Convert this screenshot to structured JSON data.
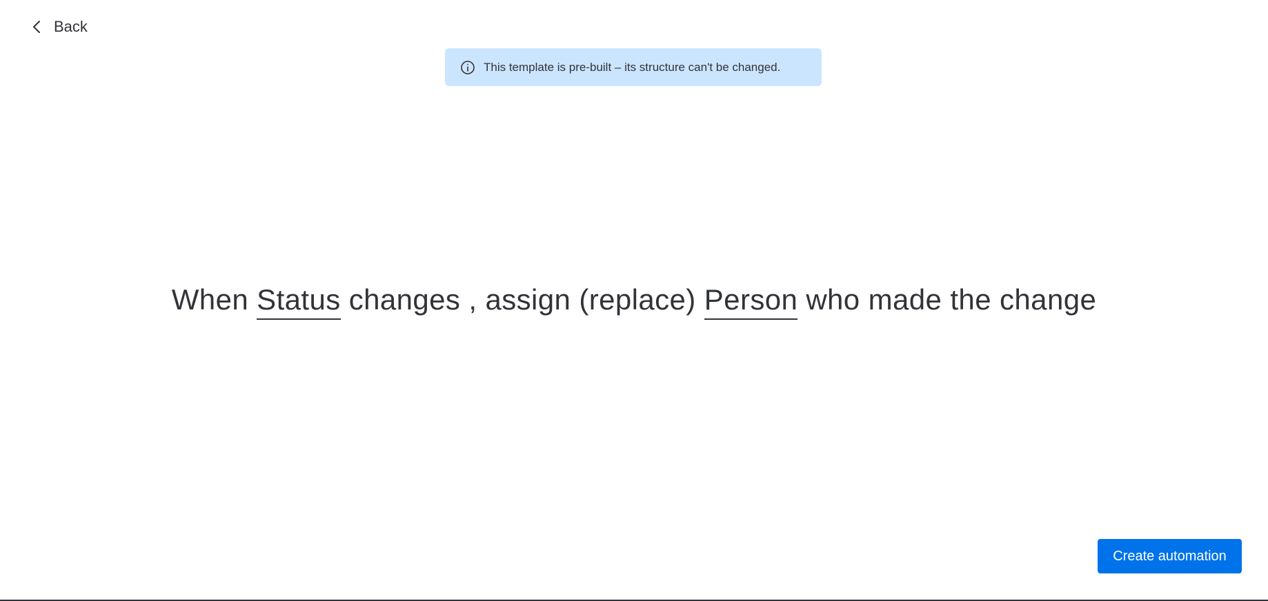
{
  "header": {
    "back_label": "Back",
    "back_icon": "chevron-left-icon"
  },
  "banner": {
    "icon": "info-icon",
    "text": "This template is pre-built – its structure can't be changed.",
    "background": "#cce5ff"
  },
  "recipe": {
    "part1": "When ",
    "field1": "Status",
    "part2": " changes , assign (replace) ",
    "field2": "Person",
    "part3": " who made the change"
  },
  "footer": {
    "create_label": "Create automation",
    "create_color": "#0073ea"
  }
}
